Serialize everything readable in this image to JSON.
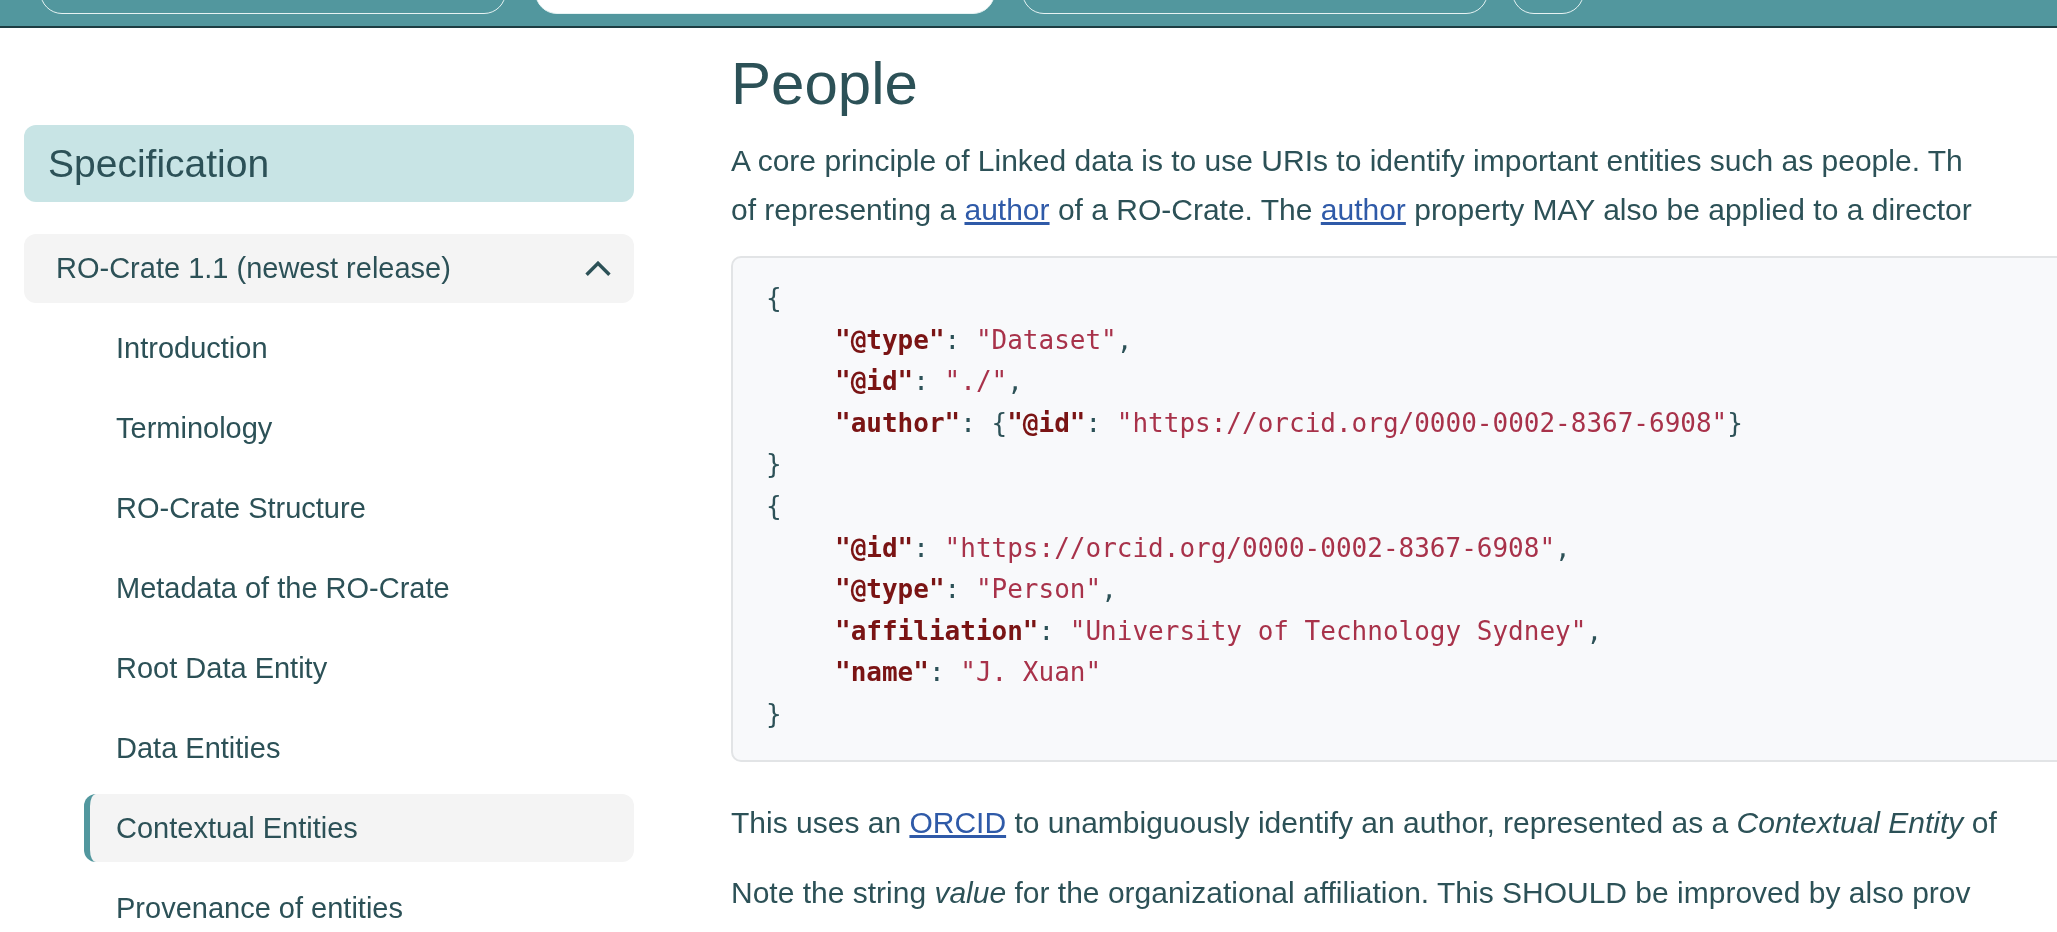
{
  "top_tabs": [
    {
      "selected": false
    },
    {
      "selected": true
    },
    {
      "selected": false
    },
    {
      "selected": false
    }
  ],
  "sidebar": {
    "title": "Specification",
    "group": {
      "label": "RO-Crate 1.1 (newest release)",
      "expanded": true,
      "items": [
        {
          "label": "Introduction",
          "selected": false
        },
        {
          "label": "Terminology",
          "selected": false
        },
        {
          "label": "RO-Crate Structure",
          "selected": false
        },
        {
          "label": "Metadata of the RO-Crate",
          "selected": false
        },
        {
          "label": "Root Data Entity",
          "selected": false
        },
        {
          "label": "Data Entities",
          "selected": false
        },
        {
          "label": "Contextual Entities",
          "selected": true
        },
        {
          "label": "Provenance of entities",
          "selected": false
        }
      ]
    }
  },
  "heading": "People",
  "intro": [
    [
      {
        "kind": "text",
        "text": "A core principle of Linked data is to use URIs to identify important entities such as people. Th"
      }
    ],
    [
      {
        "kind": "text",
        "text": "of representing a "
      },
      {
        "kind": "link",
        "text": "author"
      },
      {
        "kind": "text",
        "text": " of a RO-Crate. The "
      },
      {
        "kind": "link",
        "text": "author"
      },
      {
        "kind": "text",
        "text": " property MAY also be applied to a director"
      }
    ]
  ],
  "code": [
    {
      "indented": false,
      "tokens": [
        {
          "kind": "punct",
          "text": "{"
        }
      ]
    },
    {
      "indented": true,
      "tokens": [
        {
          "kind": "key",
          "text": "\"@type\""
        },
        {
          "kind": "punct",
          "text": ": "
        },
        {
          "kind": "string",
          "text": "\"Dataset\""
        },
        {
          "kind": "punct",
          "text": ","
        }
      ]
    },
    {
      "indented": true,
      "tokens": [
        {
          "kind": "key",
          "text": "\"@id\""
        },
        {
          "kind": "punct",
          "text": ": "
        },
        {
          "kind": "string",
          "text": "\"./\""
        },
        {
          "kind": "punct",
          "text": ","
        }
      ]
    },
    {
      "indented": true,
      "tokens": [
        {
          "kind": "key",
          "text": "\"author\""
        },
        {
          "kind": "punct",
          "text": ": {"
        },
        {
          "kind": "key",
          "text": "\"@id\""
        },
        {
          "kind": "punct",
          "text": ": "
        },
        {
          "kind": "string",
          "text": "\"https://orcid.org/0000-0002-8367-6908\""
        },
        {
          "kind": "punct",
          "text": "}"
        }
      ]
    },
    {
      "indented": false,
      "tokens": [
        {
          "kind": "punct",
          "text": "}"
        }
      ]
    },
    {
      "indented": false,
      "tokens": [
        {
          "kind": "punct",
          "text": "{"
        }
      ]
    },
    {
      "indented": true,
      "tokens": [
        {
          "kind": "key",
          "text": "\"@id\""
        },
        {
          "kind": "punct",
          "text": ": "
        },
        {
          "kind": "string",
          "text": "\"https://orcid.org/0000-0002-8367-6908\""
        },
        {
          "kind": "punct",
          "text": ","
        }
      ]
    },
    {
      "indented": true,
      "tokens": [
        {
          "kind": "key",
          "text": "\"@type\""
        },
        {
          "kind": "punct",
          "text": ": "
        },
        {
          "kind": "string",
          "text": "\"Person\""
        },
        {
          "kind": "punct",
          "text": ","
        }
      ]
    },
    {
      "indented": true,
      "tokens": [
        {
          "kind": "key",
          "text": "\"affiliation\""
        },
        {
          "kind": "punct",
          "text": ": "
        },
        {
          "kind": "string",
          "text": "\"University of Technology Sydney\""
        },
        {
          "kind": "punct",
          "text": ","
        }
      ]
    },
    {
      "indented": true,
      "tokens": [
        {
          "kind": "key",
          "text": "\"name\""
        },
        {
          "kind": "punct",
          "text": ": "
        },
        {
          "kind": "string",
          "text": "\"J. Xuan\""
        }
      ]
    },
    {
      "indented": false,
      "tokens": [
        {
          "kind": "punct",
          "text": "}"
        }
      ]
    }
  ],
  "after": [
    [
      {
        "kind": "text",
        "text": "This uses an "
      },
      {
        "kind": "link",
        "text": "ORCID"
      },
      {
        "kind": "text",
        "text": " to unambiguously identify an author, represented as a *Contextual Entity* of"
      }
    ],
    [
      {
        "kind": "text",
        "text": "Note the string *value* for the organizational affiliation. This SHOULD be improved by also prov"
      }
    ]
  ]
}
